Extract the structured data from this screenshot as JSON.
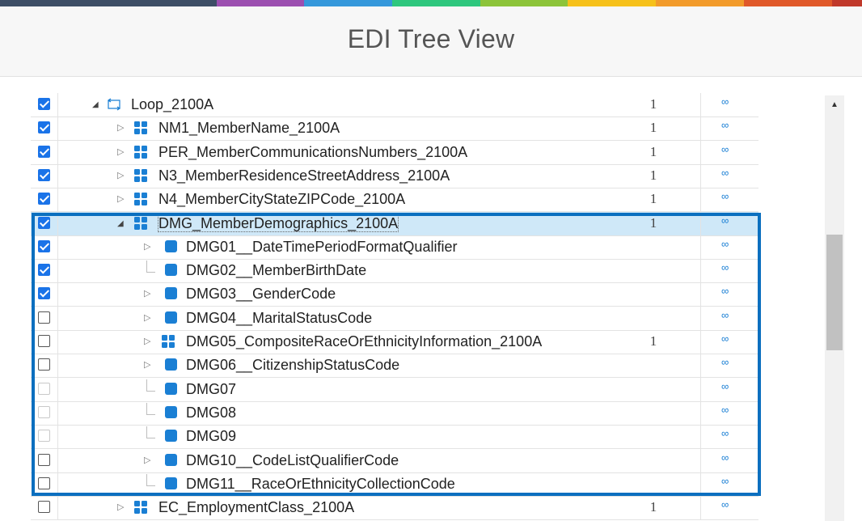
{
  "header": {
    "title": "EDI Tree View"
  },
  "brand_colors": [
    "#3d4e66",
    "#9c4fb0",
    "#3598db",
    "#2ec77e",
    "#8dc43a",
    "#f6c11a",
    "#f29b2b",
    "#e0592a",
    "#c0392b"
  ],
  "rows": [
    {
      "label": "Loop_2100A",
      "count": "1",
      "checked": true,
      "disabled": false,
      "toggle": "open",
      "icon": "loop-icon",
      "level": 0,
      "selected": false
    },
    {
      "label": "NM1_MemberName_2100A",
      "count": "1",
      "checked": true,
      "disabled": false,
      "toggle": "closed",
      "icon": "segment-icon",
      "level": 1,
      "selected": false
    },
    {
      "label": "PER_MemberCommunicationsNumbers_2100A",
      "count": "1",
      "checked": true,
      "disabled": false,
      "toggle": "closed",
      "icon": "segment-icon",
      "level": 1,
      "selected": false
    },
    {
      "label": "N3_MemberResidenceStreetAddress_2100A",
      "count": "1",
      "checked": true,
      "disabled": false,
      "toggle": "closed",
      "icon": "segment-icon",
      "level": 1,
      "selected": false
    },
    {
      "label": "N4_MemberCityStateZIPCode_2100A",
      "count": "1",
      "checked": true,
      "disabled": false,
      "toggle": "closed",
      "icon": "segment-icon",
      "level": 1,
      "selected": false
    },
    {
      "label": "DMG_MemberDemographics_2100A",
      "count": "1",
      "checked": true,
      "disabled": false,
      "toggle": "open",
      "icon": "segment-icon",
      "level": 1,
      "selected": true
    },
    {
      "label": "DMG01__DateTimePeriodFormatQualifier",
      "count": "",
      "checked": true,
      "disabled": false,
      "toggle": "closed",
      "icon": "element-icon",
      "level": 2,
      "selected": false
    },
    {
      "label": "DMG02__MemberBirthDate",
      "count": "",
      "checked": true,
      "disabled": false,
      "toggle": "leaf",
      "icon": "element-icon",
      "level": 2,
      "selected": false
    },
    {
      "label": "DMG03__GenderCode",
      "count": "",
      "checked": true,
      "disabled": false,
      "toggle": "closed",
      "icon": "element-icon",
      "level": 2,
      "selected": false
    },
    {
      "label": "DMG04__MaritalStatusCode",
      "count": "",
      "checked": false,
      "disabled": false,
      "toggle": "closed",
      "icon": "element-icon",
      "level": 2,
      "selected": false
    },
    {
      "label": "DMG05_CompositeRaceOrEthnicityInformation_2100A",
      "count": "1",
      "checked": false,
      "disabled": false,
      "toggle": "closed",
      "icon": "segment-icon",
      "level": 2,
      "selected": false
    },
    {
      "label": "DMG06__CitizenshipStatusCode",
      "count": "",
      "checked": false,
      "disabled": false,
      "toggle": "closed",
      "icon": "element-icon",
      "level": 2,
      "selected": false
    },
    {
      "label": "DMG07",
      "count": "",
      "checked": false,
      "disabled": true,
      "toggle": "leaf",
      "icon": "element-icon",
      "level": 2,
      "selected": false
    },
    {
      "label": "DMG08",
      "count": "",
      "checked": false,
      "disabled": true,
      "toggle": "leaf",
      "icon": "element-icon",
      "level": 2,
      "selected": false
    },
    {
      "label": "DMG09",
      "count": "",
      "checked": false,
      "disabled": true,
      "toggle": "leaf",
      "icon": "element-icon",
      "level": 2,
      "selected": false
    },
    {
      "label": "DMG10__CodeListQualifierCode",
      "count": "",
      "checked": false,
      "disabled": false,
      "toggle": "closed",
      "icon": "element-icon",
      "level": 2,
      "selected": false
    },
    {
      "label": "DMG11__RaceOrEthnicityCollectionCode",
      "count": "",
      "checked": false,
      "disabled": false,
      "toggle": "leaf",
      "icon": "element-icon",
      "level": 2,
      "selected": false
    },
    {
      "label": "EC_EmploymentClass_2100A",
      "count": "1",
      "checked": false,
      "disabled": false,
      "toggle": "closed",
      "icon": "segment-icon",
      "level": 1,
      "selected": false
    }
  ],
  "occurrence_symbol": "∞",
  "icons": {
    "toggle_open": "◢",
    "toggle_closed": "▷",
    "scroll_up": "▲"
  }
}
